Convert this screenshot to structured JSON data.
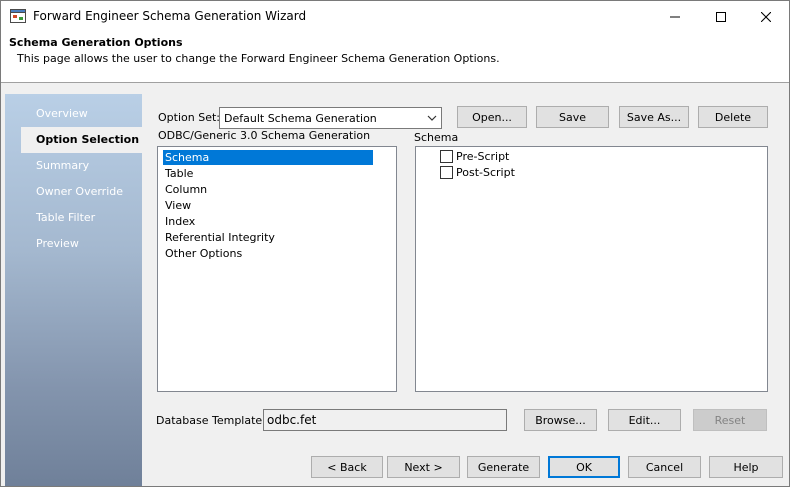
{
  "window": {
    "title": "Forward Engineer Schema Generation Wizard"
  },
  "header": {
    "title": "Schema Generation Options",
    "description": "This page allows the user to change the Forward Engineer Schema Generation Options."
  },
  "nav": {
    "items": [
      {
        "label": "Overview"
      },
      {
        "label": "Option Selection",
        "active": true
      },
      {
        "label": "Summary"
      },
      {
        "label": "Owner Override"
      },
      {
        "label": "Table Filter"
      },
      {
        "label": "Preview"
      }
    ]
  },
  "option_set": {
    "label": "Option Set:",
    "selected": "Default Schema Generation",
    "buttons": {
      "open": "Open...",
      "save": "Save",
      "save_as": "Save As...",
      "delete": "Delete"
    }
  },
  "categories": {
    "label": "ODBC/Generic 3.0 Schema Generation",
    "items": [
      "Schema",
      "Table",
      "Column",
      "View",
      "Index",
      "Referential Integrity",
      "Other Options"
    ],
    "selected_index": 0
  },
  "schema_panel": {
    "label": "Schema",
    "options": [
      {
        "label": "Pre-Script",
        "checked": false
      },
      {
        "label": "Post-Script",
        "checked": false
      }
    ]
  },
  "database_template": {
    "label": "Database Template:",
    "value": "odbc.fet",
    "buttons": {
      "browse": "Browse...",
      "edit": "Edit...",
      "reset": "Reset"
    }
  },
  "footer": {
    "back": "< Back",
    "next": "Next >",
    "generate": "Generate",
    "ok": "OK",
    "cancel": "Cancel",
    "help": "Help"
  },
  "colors": {
    "selection": "#0078d7",
    "nav_top": "#b9cfe6",
    "nav_bottom": "#6f8099"
  }
}
